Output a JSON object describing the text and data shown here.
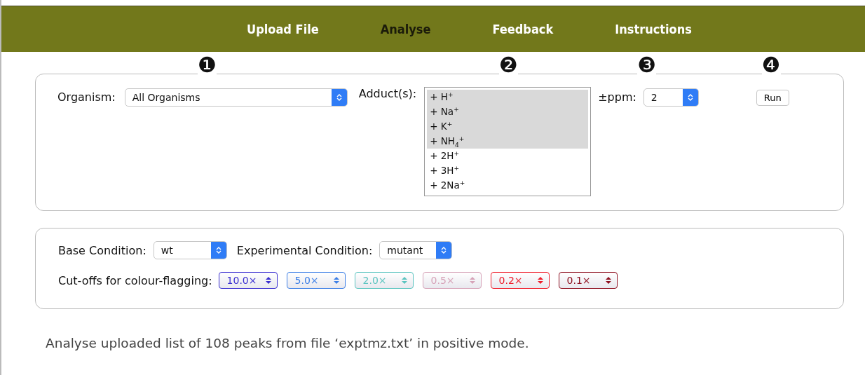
{
  "nav": [
    {
      "label": "Upload File",
      "selected": false
    },
    {
      "label": "Analyse",
      "selected": true
    },
    {
      "label": "Feedback",
      "selected": false
    },
    {
      "label": "Instructions",
      "selected": false
    }
  ],
  "markers": [
    "❶",
    "❷",
    "❸",
    "❹"
  ],
  "organism": {
    "label": "Organism:",
    "value": "All Organisms"
  },
  "adducts": {
    "label": "Adduct(s):",
    "options": [
      {
        "label": "+ H$^{+}$",
        "selected": true
      },
      {
        "label": "+ Na$^{+}$",
        "selected": true
      },
      {
        "label": "+ K$^{+}$",
        "selected": true
      },
      {
        "label": "+ NH$_{4}$$^{+}$",
        "selected": true
      },
      {
        "label": "+ 2H$^{+}$",
        "selected": false
      },
      {
        "label": "+ 3H$^{+}$",
        "selected": false
      },
      {
        "label": "+ 2Na$^{+}$",
        "selected": false
      }
    ]
  },
  "ppm": {
    "label": "±ppm:",
    "value": "2"
  },
  "run_button": "Run",
  "base_condition": {
    "label": "Base Condition:",
    "value": "wt"
  },
  "experimental_condition": {
    "label": "Experimental Condition:",
    "value": "mutant"
  },
  "cutoffs": {
    "label": "Cut-offs for colour-flagging:",
    "items": [
      {
        "value": "10.0×",
        "color": "#3a2fd0"
      },
      {
        "value": "5.0×",
        "color": "#3d7fe6"
      },
      {
        "value": "2.0×",
        "color": "#5cc4c0"
      },
      {
        "value": "0.5×",
        "color": "#d6a3b8"
      },
      {
        "value": "0.2×",
        "color": "#ee1c2a"
      },
      {
        "value": "0.1×",
        "color": "#8e1020"
      }
    ]
  },
  "status_text": "Analyse uploaded list of 108 peaks from file ‘exptmz.txt’ in positive mode."
}
